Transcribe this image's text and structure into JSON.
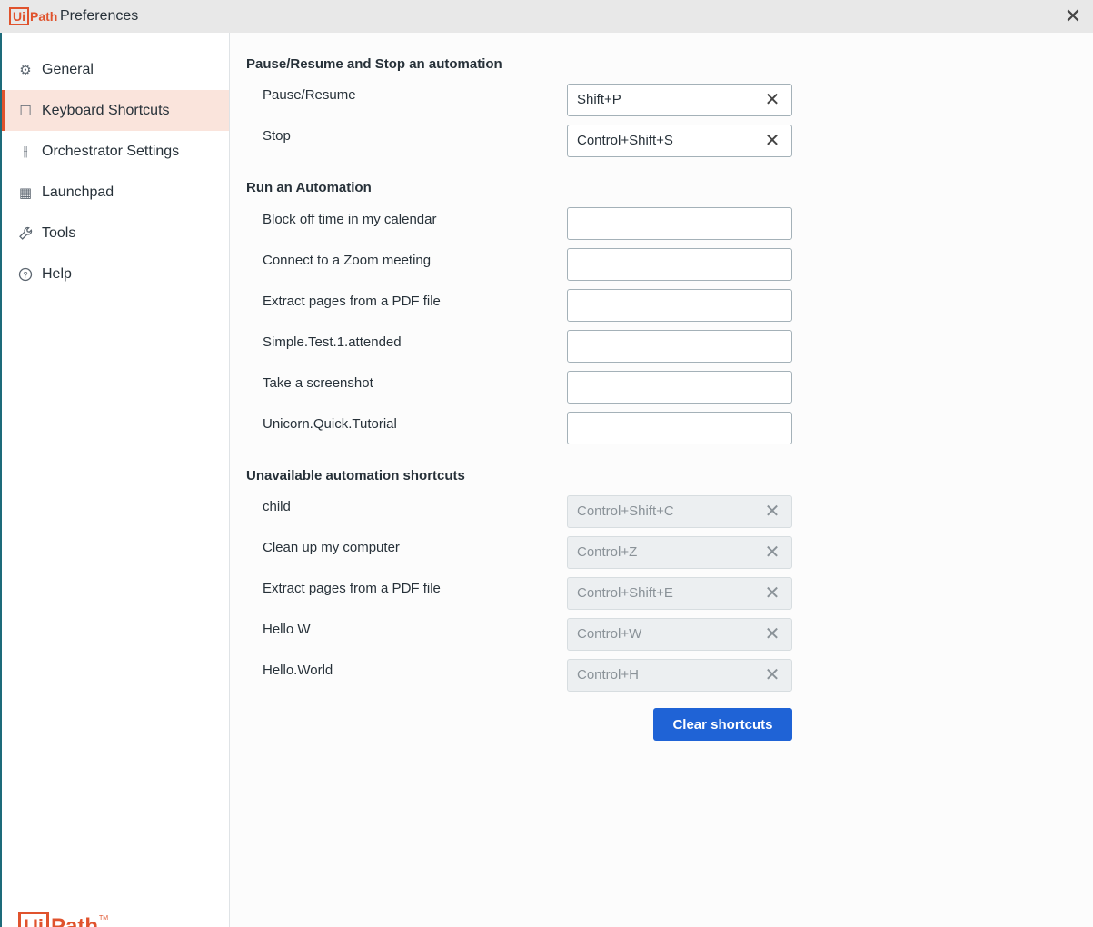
{
  "window": {
    "logo_ui": "Ui",
    "logo_path": "Path",
    "title": "Preferences",
    "close_glyph": "✕"
  },
  "sidebar": {
    "items": [
      {
        "label": "General",
        "icon": "gear-icon",
        "glyph": "⚙"
      },
      {
        "label": "Keyboard Shortcuts",
        "icon": "keyboard-shortcut-icon",
        "glyph": "☐"
      },
      {
        "label": "Orchestrator Settings",
        "icon": "sliders-icon",
        "glyph": "⫲"
      },
      {
        "label": "Launchpad",
        "icon": "grid-icon",
        "glyph": "▦"
      },
      {
        "label": "Tools",
        "icon": "wrench-icon",
        "glyph": "🔧"
      },
      {
        "label": "Help",
        "icon": "help-icon",
        "glyph": "?"
      }
    ],
    "active_index": 1,
    "bottom_logo_ui": "Ui",
    "bottom_logo_path": "Path",
    "bottom_logo_tm": "TM"
  },
  "sections": {
    "pause_stop": {
      "title": "Pause/Resume and Stop an automation",
      "rows": [
        {
          "label": "Pause/Resume",
          "value": "Shift+P"
        },
        {
          "label": "Stop",
          "value": "Control+Shift+S"
        }
      ]
    },
    "run": {
      "title": "Run an Automation",
      "rows": [
        {
          "label": "Block off time in my calendar",
          "value": ""
        },
        {
          "label": "Connect to a Zoom meeting",
          "value": ""
        },
        {
          "label": "Extract pages from a PDF file",
          "value": ""
        },
        {
          "label": "Simple.Test.1.attended",
          "value": ""
        },
        {
          "label": "Take a screenshot",
          "value": ""
        },
        {
          "label": "Unicorn.Quick.Tutorial",
          "value": ""
        }
      ]
    },
    "unavailable": {
      "title": "Unavailable automation shortcuts",
      "rows": [
        {
          "label": "child",
          "value": "Control+Shift+C"
        },
        {
          "label": "Clean up my computer",
          "value": "Control+Z"
        },
        {
          "label": "Extract pages from a PDF file",
          "value": "Control+Shift+E"
        },
        {
          "label": "Hello W",
          "value": "Control+W"
        },
        {
          "label": "Hello.World",
          "value": "Control+H"
        }
      ]
    }
  },
  "clear_icon_glyph": "✕",
  "clear_button_label": "Clear shortcuts",
  "colors": {
    "brand": "#e0532d",
    "primary": "#1f63d6",
    "active_bg": "#fae4dc"
  }
}
